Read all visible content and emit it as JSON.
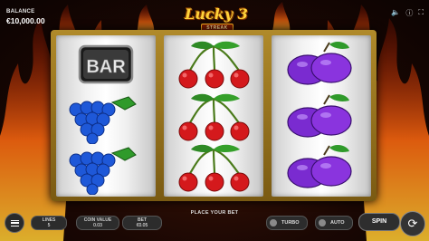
{
  "balance": {
    "label": "BALANCE",
    "value": "€10,000.00"
  },
  "logo": {
    "title": "Lucky 3",
    "subtitle": "STREAK"
  },
  "top_icons": [
    "sound-icon",
    "info-icon",
    "fullscreen-icon"
  ],
  "reels": [
    [
      "bar",
      "grapes",
      "grapes"
    ],
    [
      "cherries",
      "cherries",
      "cherries"
    ],
    [
      "plums",
      "plums",
      "plums"
    ]
  ],
  "bar_label": "BAR",
  "status": {
    "message": "PLACE YOUR BET"
  },
  "controls": {
    "lines": {
      "label": "LINES",
      "value": "5"
    },
    "coin_value": {
      "label": "COIN VALUE",
      "value": "0.03"
    },
    "bet": {
      "label": "BET",
      "value": "€0.05"
    },
    "turbo": "TURBO",
    "auto": "AUTO",
    "spin": "SPIN"
  },
  "colors": {
    "frame_gold": "#b08a2a",
    "cherry_red": "#d4191c",
    "grape_blue": "#1e58d8",
    "plum_purple": "#7a2bd0"
  }
}
